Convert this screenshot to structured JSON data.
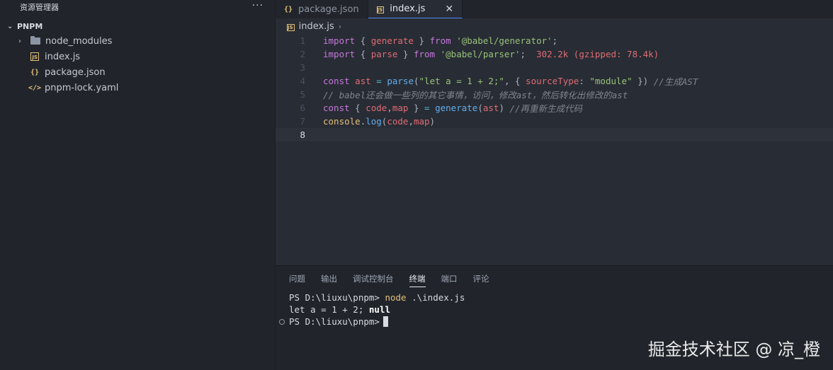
{
  "explorer": {
    "title": "资源管理器",
    "more": "···",
    "root_folder": "PNPM",
    "items": [
      {
        "label": "node_modules",
        "type": "folder"
      },
      {
        "label": "index.js",
        "type": "js"
      },
      {
        "label": "package.json",
        "type": "json"
      },
      {
        "label": "pnpm-lock.yaml",
        "type": "yaml"
      }
    ]
  },
  "tabs": [
    {
      "label": "package.json",
      "icon": "json-icon"
    },
    {
      "label": "index.js",
      "icon": "js-icon",
      "close": "✕"
    }
  ],
  "breadcrumb": {
    "file": "index.js",
    "sep": "›"
  },
  "editor": {
    "lines": [
      {
        "n": "1"
      },
      {
        "n": "2"
      },
      {
        "n": "3"
      },
      {
        "n": "4"
      },
      {
        "n": "5"
      },
      {
        "n": "6"
      },
      {
        "n": "7"
      },
      {
        "n": "8"
      }
    ],
    "import_size": "302.2k (gzipped: 78.4k)",
    "comment_4": "//生成AST",
    "comment_5": "// babel还会做一些列的其它事情，访问，修改ast，然后转化出修改的ast",
    "comment_6": "//再重新生成代码"
  },
  "panel": {
    "tabs": [
      "问题",
      "输出",
      "调试控制台",
      "终端",
      "端口",
      "评论"
    ],
    "active_tab": "终端",
    "terminal": {
      "prompt1": "PS D:\\liuxu\\pnpm> ",
      "cmd": "node",
      "args": " .\\index.js",
      "output": "let a = 1 + 2; ",
      "output_null": "null",
      "prompt2": "PS D:\\liuxu\\pnpm>"
    }
  },
  "watermark": "掘金技术社区 @ 凉_橙",
  "colors": {
    "accent": "#528bff",
    "keyword": "#c678dd",
    "function": "#61afef",
    "string": "#98c379",
    "variable": "#e06c75"
  }
}
